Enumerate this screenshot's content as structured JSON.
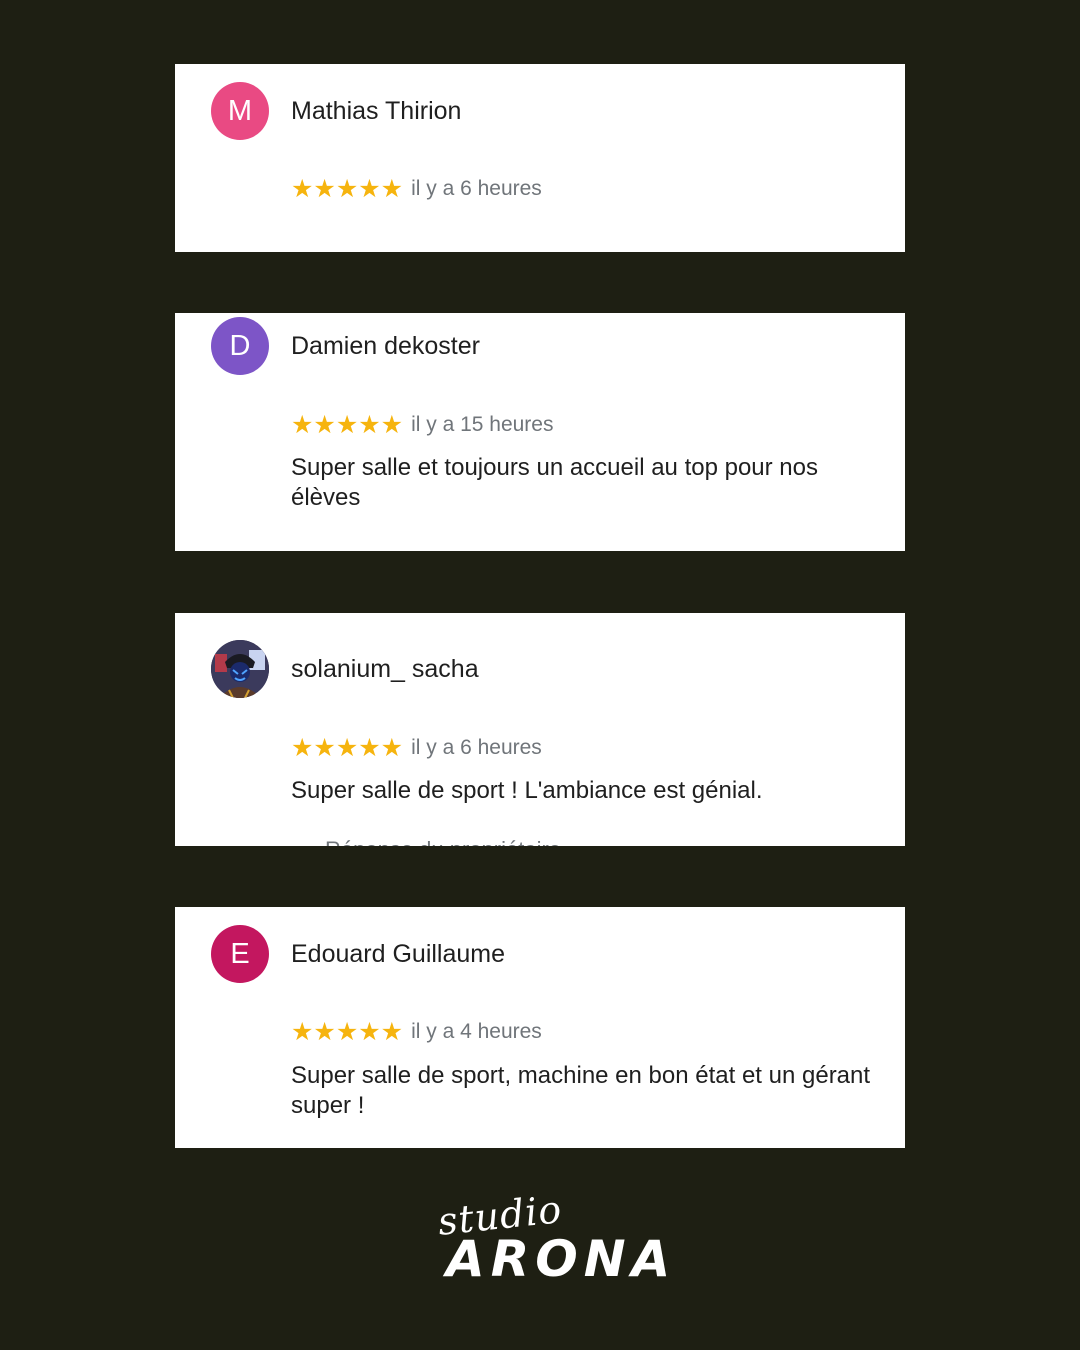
{
  "reviews": [
    {
      "initial": "M",
      "avatar_color": "#e94a83",
      "name": "Mathias Thirion",
      "stars": "★★★★★",
      "time": "il y a 6 heures",
      "text": ""
    },
    {
      "initial": "D",
      "avatar_color": "#7d55c7",
      "name": "Damien dekoster",
      "stars": "★★★★★",
      "time": "il y a 15 heures",
      "text": "Super salle et toujours un accueil au top pour nos élèves"
    },
    {
      "initial": "",
      "avatar_color": "#2a2440",
      "avatar_icon": "user-photo",
      "name": "solanium_ sacha",
      "stars": "★★★★★",
      "time": "il y a 6 heures",
      "text": "Super salle de sport ! L'ambiance est génial.",
      "cut_text": "Réponse du propriétaire"
    },
    {
      "initial": "E",
      "avatar_color": "#c3175f",
      "name": "Edouard Guillaume",
      "stars": "★★★★★",
      "time": "il y a 4 heures",
      "text": "Super salle de sport, machine en bon état et un gérant super !"
    }
  ],
  "logo": {
    "script": "studio",
    "word": "ARONA"
  },
  "colors": {
    "background": "#1e1f13",
    "star": "#f6b40e"
  }
}
